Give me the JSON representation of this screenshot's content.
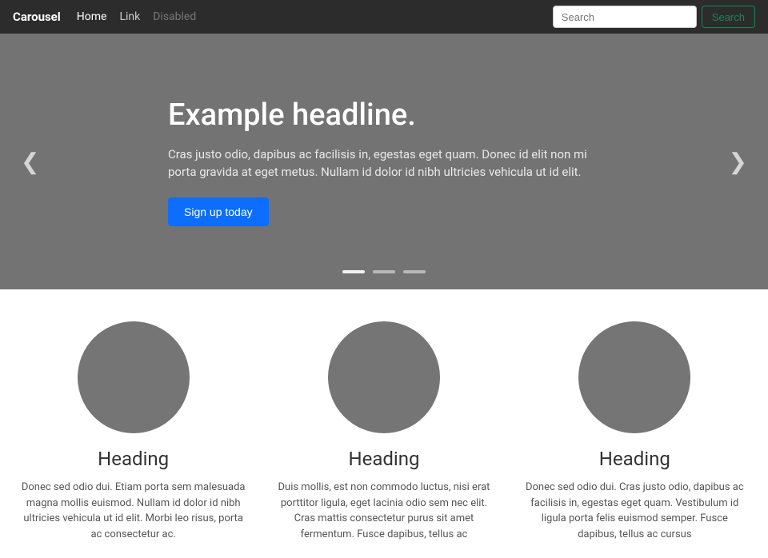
{
  "navbar": {
    "brand": "Carousel",
    "links": [
      {
        "label": "Home",
        "state": "active"
      },
      {
        "label": "Link",
        "state": "normal"
      },
      {
        "label": "Disabled",
        "state": "disabled"
      }
    ],
    "search": {
      "placeholder": "Search",
      "button_label": "Search"
    }
  },
  "carousel": {
    "headline": "Example headline.",
    "text": "Cras justo odio, dapibus ac facilisis in, egestas eget quam. Donec id elit non mi porta gravida at eget metus. Nullam id dolor id nibh ultricies vehicula ut id elit.",
    "button_label": "Sign up today",
    "prev_arrow": "❮",
    "next_arrow": "❯",
    "indicators": [
      {
        "active": true
      },
      {
        "active": false
      },
      {
        "active": false
      }
    ]
  },
  "cards": [
    {
      "heading": "Heading",
      "text": "Donec sed odio dui. Etiam porta sem malesuada magna mollis euismod. Nullam id dolor id nibh ultricies vehicula ut id elit. Morbi leo risus, porta ac consectetur ac."
    },
    {
      "heading": "Heading",
      "text": "Duis mollis, est non commodo luctus, nisi erat porttitor ligula, eget lacinia odio sem nec elit. Cras mattis consectetur purus sit amet fermentum. Fusce dapibus, tellus ac"
    },
    {
      "heading": "Heading",
      "text": "Donec sed odio dui. Cras justo odio, dapibus ac facilisis in, egestas eget quam. Vestibulum id ligula porta felis euismod semper. Fusce dapibus, tellus ac cursus"
    }
  ]
}
